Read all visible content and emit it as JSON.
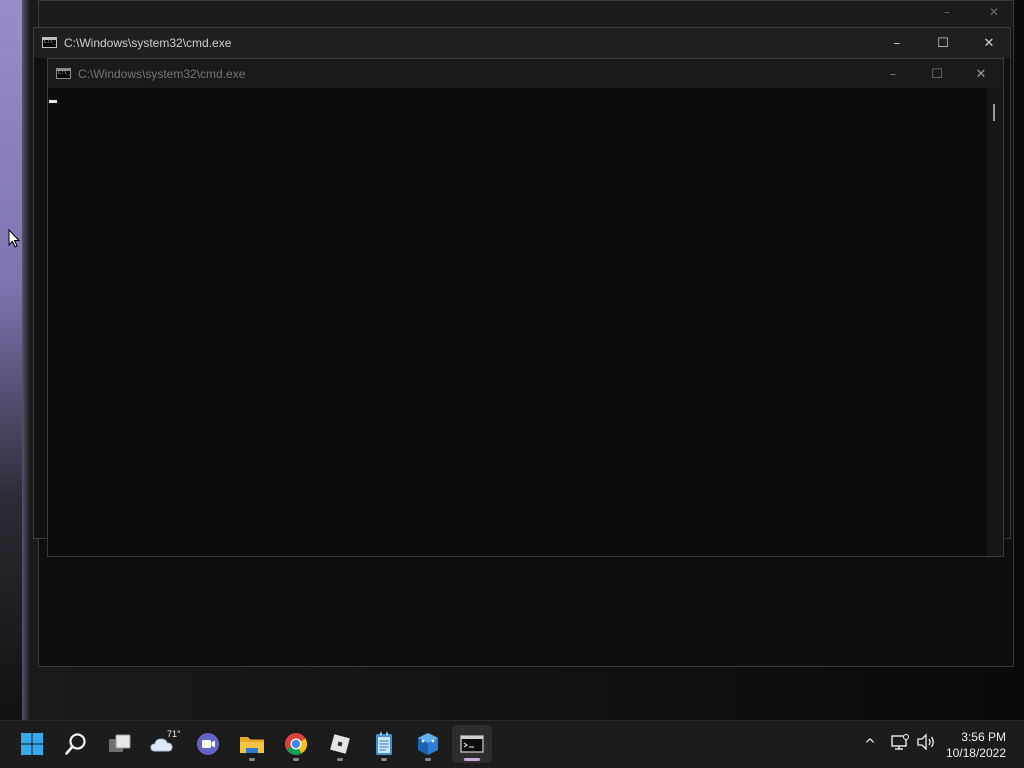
{
  "front_window": {
    "title": "C:\\Windows\\system32\\cmd.exe",
    "controls": {
      "minimize": "–",
      "maximize": "☐",
      "close": "✕"
    }
  },
  "middle_window": {
    "title": "C:\\Windows\\system32\\cmd.exe",
    "controls": {
      "minimize": "–",
      "maximize": "☐",
      "close": "✕"
    }
  },
  "back_window": {
    "controls": {
      "minimize": "–",
      "close": "✕"
    }
  },
  "taskbar": {
    "apps": [
      {
        "name": "start-button",
        "icon": "windows-logo-icon"
      },
      {
        "name": "search-button",
        "icon": "search-icon"
      },
      {
        "name": "task-view-button",
        "icon": "task-view-icon"
      },
      {
        "name": "widgets-button",
        "icon": "weather-icon"
      },
      {
        "name": "teams-chat-button",
        "icon": "video-chat-icon"
      },
      {
        "name": "file-explorer-button",
        "icon": "folder-icon"
      },
      {
        "name": "chrome-button",
        "icon": "chrome-icon"
      },
      {
        "name": "roblox-button",
        "icon": "roblox-icon"
      },
      {
        "name": "notepad-button",
        "icon": "notepad-icon"
      },
      {
        "name": "app-button",
        "icon": "blue-cube-icon"
      },
      {
        "name": "cmd-button",
        "icon": "terminal-icon"
      }
    ],
    "weather_temp": "71°",
    "tray": {
      "overflow": "^",
      "time": "3:56 PM",
      "date": "10/18/2022"
    }
  }
}
